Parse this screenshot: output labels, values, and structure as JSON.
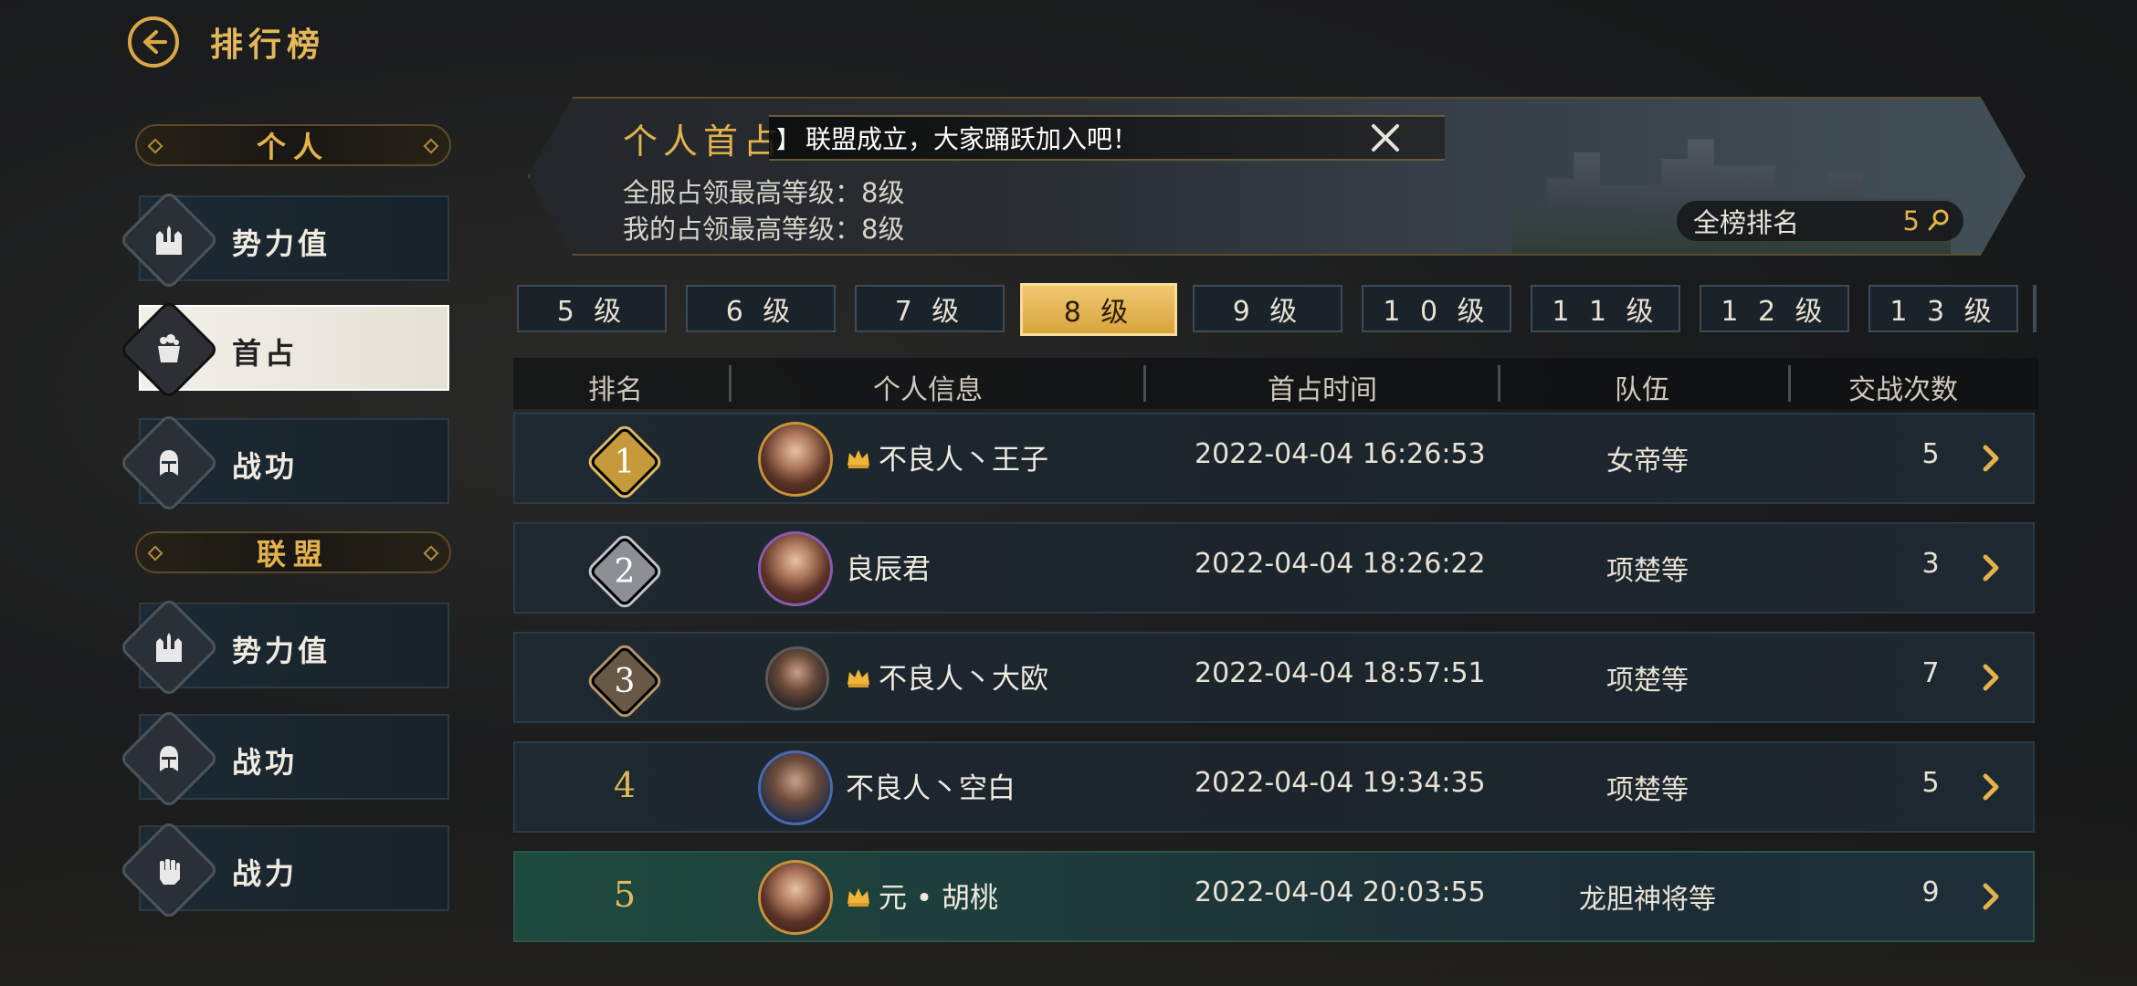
{
  "header": {
    "title": "排行榜"
  },
  "sidebar": {
    "personal_header": "个人",
    "alliance_header": "联盟",
    "personal_items": [
      {
        "label": "势力值",
        "icon": "castle-icon"
      },
      {
        "label": "首占",
        "icon": "cauldron-icon",
        "active": true
      },
      {
        "label": "战功",
        "icon": "helmet-icon"
      }
    ],
    "alliance_items": [
      {
        "label": "势力值",
        "icon": "castle-icon"
      },
      {
        "label": "战功",
        "icon": "helmet-icon"
      },
      {
        "label": "战力",
        "icon": "fist-icon"
      }
    ]
  },
  "banner": {
    "title": "个人首占",
    "notice_mark": "】",
    "notice": "联盟成立，大家踊跃加入吧！",
    "server_highest": "全服占领最高等级：8级",
    "my_highest": "我的占领最高等级：8级",
    "rank_label": "全榜排名",
    "rank_value": "5"
  },
  "level_tabs": [
    "5 级",
    "6 级",
    "7 级",
    "8 级",
    "9 级",
    "1 0 级",
    "1 1 级",
    "1 2 级",
    "1 3 级"
  ],
  "active_tab": "8 级",
  "table": {
    "headers": [
      "排名",
      "个人信息",
      "首占时间",
      "队伍",
      "交战次数"
    ],
    "rows": [
      {
        "rank": "1",
        "name": "不良人丶王子",
        "time": "2022-04-04 16:26:53",
        "team": "女帝等",
        "count": "5"
      },
      {
        "rank": "2",
        "name": "良辰君",
        "time": "2022-04-04 18:26:22",
        "team": "项楚等",
        "count": "3"
      },
      {
        "rank": "3",
        "name": "不良人丶大欧",
        "time": "2022-04-04 18:57:51",
        "team": "项楚等",
        "count": "7"
      },
      {
        "rank": "4",
        "name": "不良人丶空白",
        "time": "2022-04-04 19:34:35",
        "team": "项楚等",
        "count": "5"
      },
      {
        "rank": "5",
        "name": "元 • 胡桃",
        "time": "2022-04-04 20:03:55",
        "team": "龙胆神将等",
        "count": "9"
      }
    ]
  },
  "colors": {
    "accent": "#e3b24c",
    "active_tab": "#d9a43e",
    "my_row": "#1e4a3e"
  }
}
